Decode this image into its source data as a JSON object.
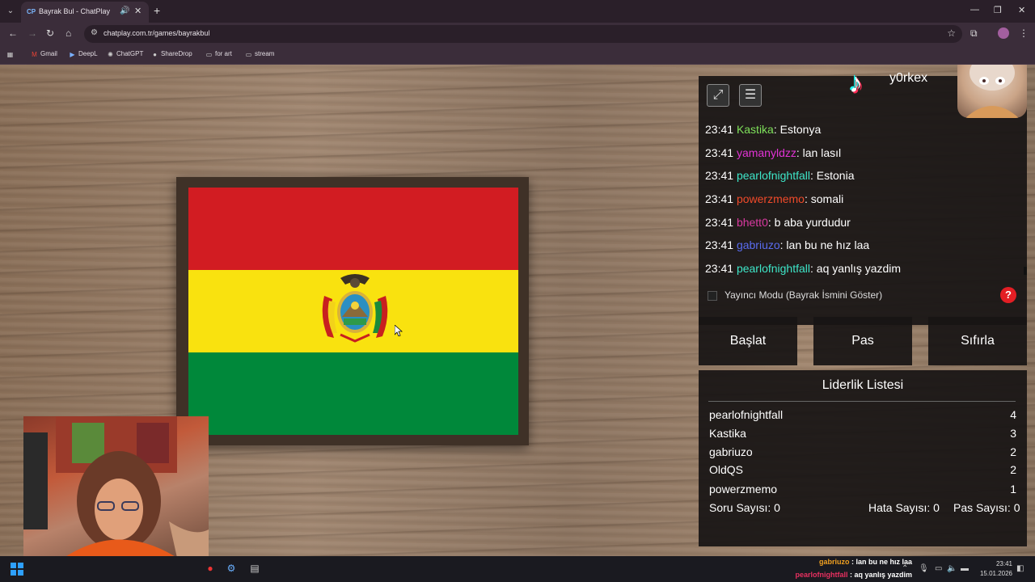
{
  "browser": {
    "tab_title": "Bayrak Bul - ChatPlay",
    "url": "chatplay.com.tr/games/bayrakbul",
    "bookmarks": [
      "Gmail",
      "DeepL",
      "ChatGPT",
      "ShareDrop",
      "for art",
      "stream"
    ]
  },
  "flag": {
    "country_colors": [
      "#d21c22",
      "#f9e20f",
      "#00883a"
    ]
  },
  "stream": {
    "username": "y0rkex"
  },
  "chat": {
    "messages": [
      {
        "time": "23:41",
        "user": "Kastika",
        "user_color": "#7ee05a",
        "text": "Estonya"
      },
      {
        "time": "23:41",
        "user": "yamanyldzz",
        "user_color": "#e233d6",
        "text": "lan lasıl"
      },
      {
        "time": "23:41",
        "user": "pearlofnightfall",
        "user_color": "#3ee6c8",
        "text": "Estonia"
      },
      {
        "time": "23:41",
        "user": "powerzmemo",
        "user_color": "#f04a2a",
        "text": "somali"
      },
      {
        "time": "23:41",
        "user": "bhett0",
        "user_color": "#d93aa0",
        "text": "b aba yurdudur"
      },
      {
        "time": "23:41",
        "user": "gabriuzo",
        "user_color": "#5a6cf0",
        "text": "lan bu ne hız laa"
      },
      {
        "time": "23:41",
        "user": "pearlofnightfall",
        "user_color": "#3ee6c8",
        "text": "aq yanlış yazdim"
      }
    ],
    "streamer_mode_label": "Yayıncı Modu (Bayrak İsmini Göster)",
    "help_label": "?"
  },
  "controls": {
    "start": "Başlat",
    "pass": "Pas",
    "reset": "Sıfırla"
  },
  "leaderboard": {
    "title": "Liderlik Listesi",
    "rows": [
      {
        "name": "pearlofnightfall",
        "score": "4"
      },
      {
        "name": "Kastika",
        "score": "3"
      },
      {
        "name": "gabriuzo",
        "score": "2"
      },
      {
        "name": "OldQS",
        "score": "2"
      },
      {
        "name": "powerzmemo",
        "score": "1"
      }
    ],
    "question_count": "Soru Sayısı: 0",
    "error_count": "Hata Sayısı: 0",
    "pass_count": "Pas Sayısı: 0"
  },
  "taskbar": {
    "overlay_chat": [
      {
        "user": "gabriuzo",
        "user_color": "#f0a020",
        "text": "lan bu ne hız laa"
      },
      {
        "user": "pearlofnightfall",
        "user_color": "#e83060",
        "text": "aq yanlış yazdim"
      }
    ],
    "time": "23:41",
    "date": "15.01.2026"
  }
}
